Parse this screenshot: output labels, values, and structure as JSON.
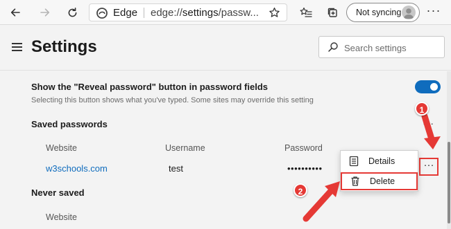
{
  "toolbar": {
    "brand": "Edge",
    "url_prefix": "edge://",
    "url_strong": "settings",
    "url_rest": "/passw...",
    "sync_label": "Not syncing",
    "more_label": "···"
  },
  "header": {
    "title": "Settings",
    "search_placeholder": "Search settings"
  },
  "reveal": {
    "title": "Show the \"Reveal password\" button in password fields",
    "description": "Selecting this button shows what you've typed. Some sites may override this setting",
    "enabled": true
  },
  "saved": {
    "title": "Saved passwords",
    "more_label": "···",
    "columns": [
      "Website",
      "Username",
      "Password"
    ],
    "rows": [
      {
        "website": "w3schools.com",
        "username": "test",
        "password": "••••••••••",
        "more_label": "···"
      }
    ]
  },
  "context_menu": {
    "items": [
      {
        "label": "Details",
        "icon": "details-icon"
      },
      {
        "label": "Delete",
        "icon": "trash-icon"
      }
    ]
  },
  "never_saved": {
    "title": "Never saved",
    "column": "Website"
  },
  "annotations": {
    "step1": "1",
    "step2": "2",
    "color": "#e53935"
  },
  "colors": {
    "accent": "#0f6cbd",
    "link": "#0f6cbd",
    "highlight": "#e53935"
  }
}
